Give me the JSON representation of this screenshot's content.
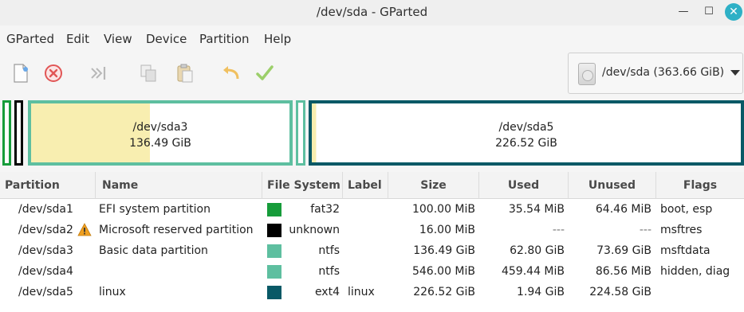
{
  "window": {
    "title": "/dev/sda - GParted",
    "close_symbol": "✕",
    "minimize_symbol": "—",
    "maximize_symbol": "☐"
  },
  "menu": [
    "GParted",
    "Edit",
    "View",
    "Device",
    "Partition",
    "Help"
  ],
  "toolbar": {
    "icons": [
      "new-icon",
      "delete-icon",
      "resize-move-icon",
      "copy-icon",
      "paste-icon",
      "undo-icon",
      "apply-icon"
    ]
  },
  "device_selector": {
    "label": "/dev/sda (363.66 GiB)"
  },
  "partition_map": [
    {
      "name": "/dev/sda3",
      "size": "136.49 GiB"
    },
    {
      "name": "/dev/sda5",
      "size": "226.52 GiB"
    }
  ],
  "colors": {
    "fat32": "#169c3a",
    "unknown": "#000000",
    "ntfs": "#5ebfa0",
    "ext4": "#085966",
    "used_fill": "#f8eeb0",
    "warning": "#f0a020"
  },
  "table": {
    "columns": [
      "Partition",
      "Name",
      "File System",
      "Label",
      "Size",
      "Used",
      "Unused",
      "Flags"
    ],
    "rows": [
      {
        "partition": "/dev/sda1",
        "name": "EFI system partition",
        "fs": "fat32",
        "label": "",
        "size": "100.00 MiB",
        "used": "35.54 MiB",
        "unused": "64.46 MiB",
        "flags": "boot, esp"
      },
      {
        "partition": "/dev/sda2",
        "name": "Microsoft reserved partition",
        "fs": "unknown",
        "label": "",
        "size": "16.00 MiB",
        "used": "---",
        "unused": "---",
        "flags": "msftres"
      },
      {
        "partition": "/dev/sda3",
        "name": "Basic data partition",
        "fs": "ntfs",
        "label": "",
        "size": "136.49 GiB",
        "used": "62.80 GiB",
        "unused": "73.69 GiB",
        "flags": "msftdata"
      },
      {
        "partition": "/dev/sda4",
        "name": "",
        "fs": "ntfs",
        "label": "",
        "size": "546.00 MiB",
        "used": "459.44 MiB",
        "unused": "86.56 MiB",
        "flags": "hidden, diag"
      },
      {
        "partition": "/dev/sda5",
        "name": "linux",
        "fs": "ext4",
        "label": "linux",
        "size": "226.52 GiB",
        "used": "1.94 GiB",
        "unused": "224.58 GiB",
        "flags": ""
      }
    ]
  }
}
